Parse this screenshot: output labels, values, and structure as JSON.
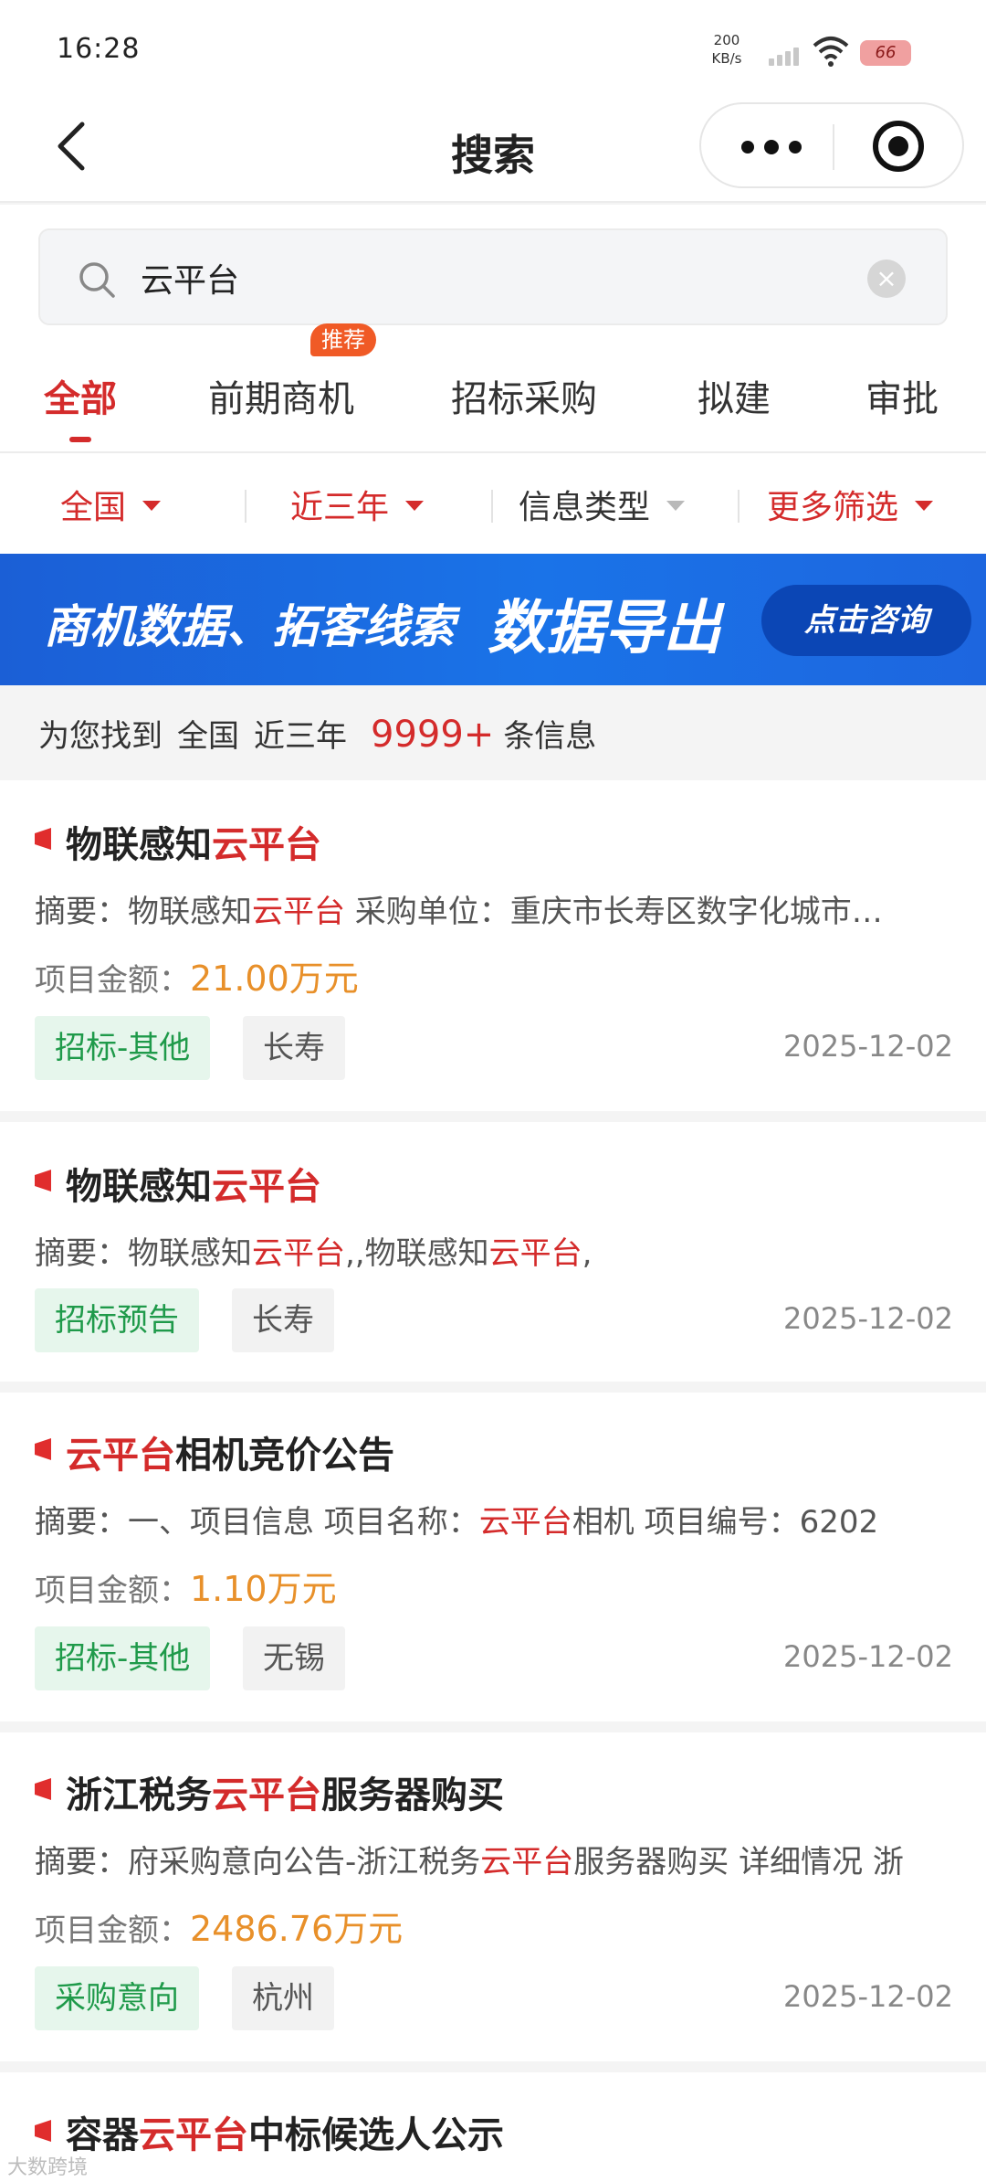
{
  "status_bar": {
    "time": "16:28",
    "speed_value": "200",
    "speed_unit": "KB/s",
    "battery": "66"
  },
  "nav": {
    "title": "搜索"
  },
  "search": {
    "value": "云平台"
  },
  "tabs": [
    {
      "label": "全部"
    },
    {
      "label": "前期商机",
      "badge": "推荐"
    },
    {
      "label": "招标采购"
    },
    {
      "label": "拟建"
    },
    {
      "label": "审批"
    }
  ],
  "filters": [
    {
      "label": "全国"
    },
    {
      "label": "近三年"
    },
    {
      "label": "信息类型"
    },
    {
      "label": "更多筛选"
    }
  ],
  "banner": {
    "text_left": "商机数据、拓客线索",
    "text_big": "数据导出",
    "cta": "点击咨询"
  },
  "result_summary": {
    "prefix": "为您找到",
    "region": "全国",
    "period": "近三年",
    "count": "9999+",
    "suffix": "条信息"
  },
  "results": [
    {
      "title_pre": "物联感知",
      "title_hl": "云平台",
      "title_post": "",
      "summary_label": "摘要：",
      "summary_parts": [
        "物联感知",
        "云平台",
        " 采购单位：重庆市长寿区数字化城市…"
      ],
      "amount_label": "项目金额：",
      "amount": "21.00万元",
      "type": "招标-其他",
      "region": "长寿",
      "date": "2025-12-02"
    },
    {
      "title_pre": "物联感知",
      "title_hl": "云平台",
      "title_post": "",
      "summary_label": "摘要：",
      "summary_parts": [
        "物联感知",
        "云平台",
        ",,物联感知",
        "云平台",
        ","
      ],
      "type": "招标预告",
      "region": "长寿",
      "date": "2025-12-02"
    },
    {
      "title_pre": "",
      "title_hl": "云平台",
      "title_post": "相机竞价公告",
      "summary_label": "摘要：",
      "summary_parts": [
        "一、项目信息 项目名称：",
        "云平台",
        "相机 项目编号：6202"
      ],
      "amount_label": "项目金额：",
      "amount": "1.10万元",
      "type": "招标-其他",
      "region": "无锡",
      "date": "2025-12-02"
    },
    {
      "title_pre": "浙江税务",
      "title_hl": "云平台",
      "title_post": "服务器购买",
      "summary_label": "摘要：",
      "summary_parts": [
        "府采购意向公告-浙江税务",
        "云平台",
        "服务器购买 详细情况 浙"
      ],
      "amount_label": "项目金额：",
      "amount": "2486.76万元",
      "type": "采购意向",
      "region": "杭州",
      "date": "2025-12-02"
    },
    {
      "title_pre": "容器",
      "title_hl": "云平台",
      "title_post": "中标候选人公示"
    }
  ],
  "watermark": "大数跨境",
  "colors": {
    "accent_red": "#d42b2b",
    "amount_orange": "#e8902a",
    "type_green": "#1f9a4a",
    "banner_blue": "#1a73e8"
  }
}
